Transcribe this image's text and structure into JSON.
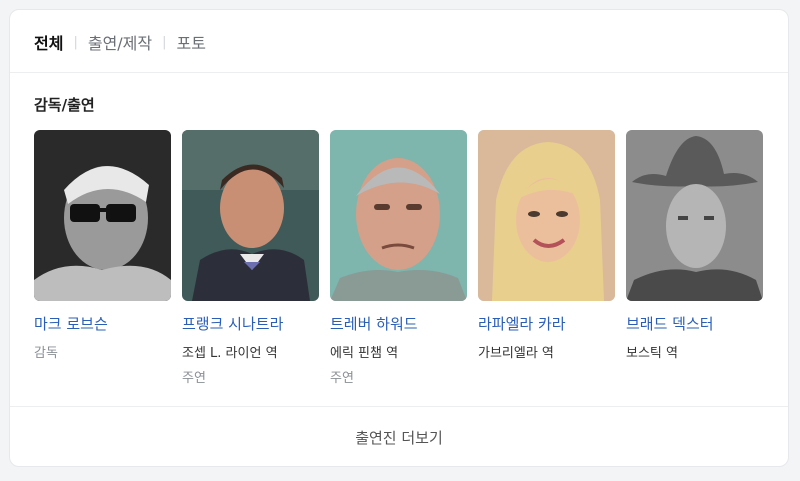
{
  "tabs": [
    {
      "label": "전체",
      "active": true
    },
    {
      "label": "출연/제작",
      "active": false
    },
    {
      "label": "포토",
      "active": false
    }
  ],
  "section_title": "감독/출연",
  "people": [
    {
      "name": "마크 로브슨",
      "role": "감독",
      "sub": ""
    },
    {
      "name": "프랭크 시나트라",
      "role": "조셉 L. 라이언 역",
      "sub": "주연"
    },
    {
      "name": "트레버 하워드",
      "role": "에릭 핀챔 역",
      "sub": "주연"
    },
    {
      "name": "라파엘라 카라",
      "role": "가브리엘라 역",
      "sub": ""
    },
    {
      "name": "브래드 덱스터",
      "role": "보스틱 역",
      "sub": ""
    }
  ],
  "more_label": "출연진 더보기"
}
